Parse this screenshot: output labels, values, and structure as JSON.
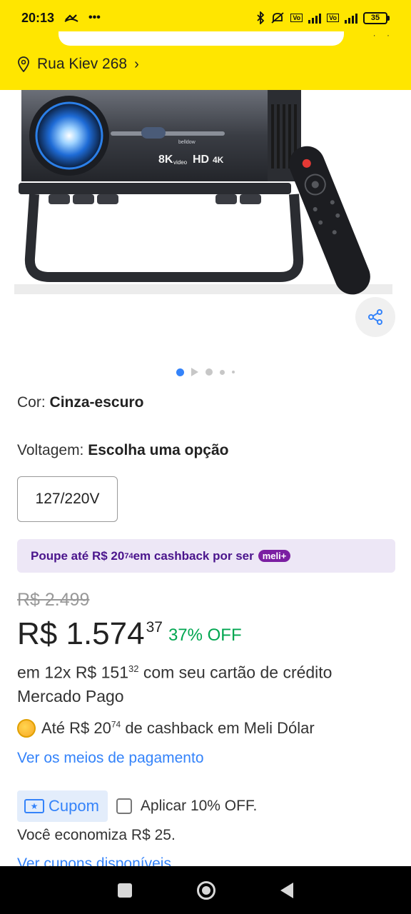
{
  "status_bar": {
    "time": "20:13",
    "battery": "35"
  },
  "header": {
    "address": "Rua Kiev 268",
    "address_chevron": "›"
  },
  "product_image": {
    "brand_text": "belldow",
    "badge_text_8k": "8K",
    "badge_text_video": "video",
    "badge_text_hd": "HD",
    "badge_text_4k": "4K"
  },
  "gallery": {
    "dots_total": 5,
    "active_index": 0
  },
  "color": {
    "label": "Cor:",
    "value": "Cinza-escuro"
  },
  "voltage": {
    "label": "Voltagem:",
    "value": "Escolha uma opção",
    "options": [
      "127/220V"
    ]
  },
  "cashback_banner": {
    "text_prefix": "Poupe até R$ 20",
    "cents": "74",
    "text_suffix": " em cashback por ser",
    "badge": "meli+"
  },
  "price": {
    "original": "R$ 2.499",
    "main": "R$ 1.574",
    "cents": "37",
    "discount": "37% OFF"
  },
  "installments": {
    "prefix": "em 12x R$ 151",
    "cents": "32",
    "suffix": " com seu cartão de crédito Mercado Pago"
  },
  "meli_dolar": {
    "prefix": "Até R$ 20",
    "cents": "74",
    "suffix": " de cashback em Meli Dólar"
  },
  "payment_link": "Ver os meios de pagamento",
  "coupon": {
    "chip_label": "Cupom",
    "apply_text": "Aplicar 10% OFF.",
    "savings_text": "Você economiza R$ 25.",
    "more_link": "Ver cupons disponíveis"
  },
  "colors": {
    "header_yellow": "#ffe600",
    "link_blue": "#3483fa",
    "discount_green": "#00a650",
    "meli_purple": "#7b1fa2"
  },
  "icons": [
    "location-pin-icon",
    "share-icon",
    "coin-icon",
    "coupon-icon",
    "checkbox-icon",
    "bluetooth-icon",
    "wifi-icon",
    "battery-icon"
  ]
}
